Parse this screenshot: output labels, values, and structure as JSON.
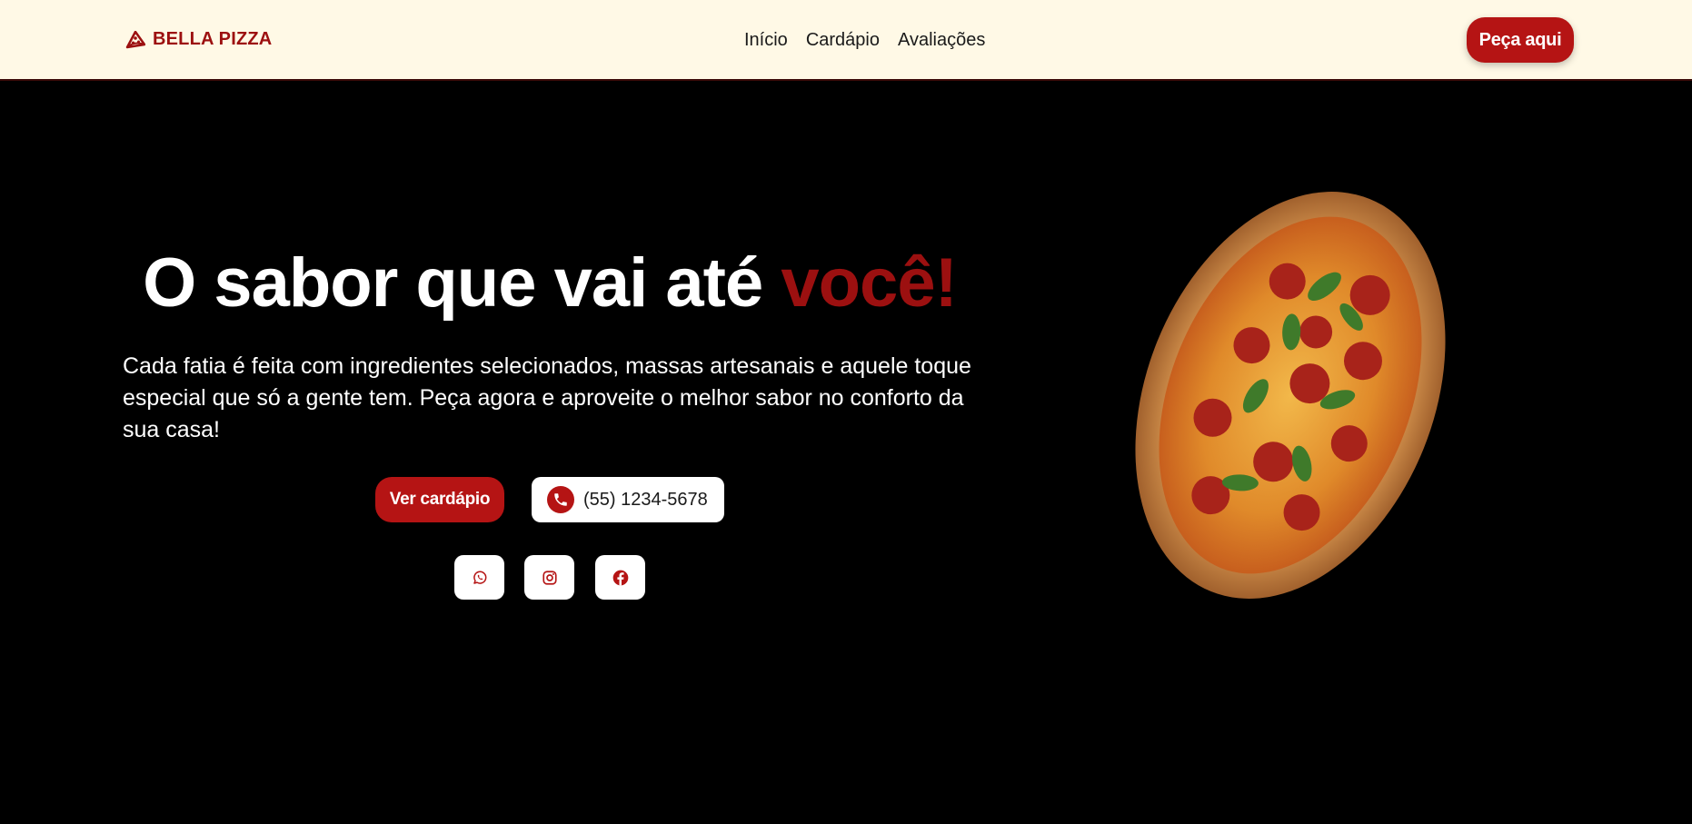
{
  "header": {
    "brand": {
      "name": "BELLA PIZZA",
      "icon": "pizza-slice-icon"
    },
    "nav": [
      "Início",
      "Cardápio",
      "Avaliações"
    ],
    "order_label": "Peça aqui"
  },
  "hero": {
    "title_main": "O sabor que vai até",
    "title_accent": "você!",
    "description": "Cada fatia é feita com ingredientes selecionados, massas artesanais e aquele toque especial que só a gente tem. Peça agora e aproveite o melhor sabor no conforto da sua casa!",
    "menu_button": "Ver cardápio",
    "phone": "(55) 1234-5678",
    "social_icons": [
      "whatsapp-icon",
      "instagram-icon",
      "facebook-icon"
    ],
    "image": "pizza-image"
  },
  "colors": {
    "brand_red": "#b51414",
    "accent_text": "#9c1010",
    "header_bg": "#fff9e6",
    "hero_bg": "#000000"
  }
}
